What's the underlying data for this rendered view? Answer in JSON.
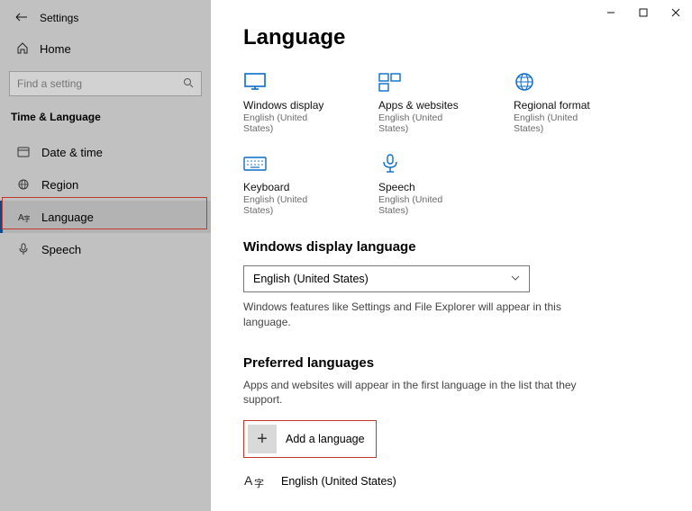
{
  "window": {
    "title": "Settings"
  },
  "sidebar": {
    "home": "Home",
    "search_placeholder": "Find a setting",
    "category": "Time & Language",
    "items": [
      {
        "label": "Date & time",
        "icon": "clock"
      },
      {
        "label": "Region",
        "icon": "globe"
      },
      {
        "label": "Language",
        "icon": "lang",
        "selected": true
      },
      {
        "label": "Speech",
        "icon": "mic"
      }
    ]
  },
  "page": {
    "title": "Language",
    "tiles": [
      {
        "name": "Windows display",
        "sub": "English (United States)",
        "icon": "monitor"
      },
      {
        "name": "Apps & websites",
        "sub": "English (United States)",
        "icon": "apps"
      },
      {
        "name": "Regional format",
        "sub": "English (United States)",
        "icon": "globe2"
      },
      {
        "name": "Keyboard",
        "sub": "English (United States)",
        "icon": "keyboard"
      },
      {
        "name": "Speech",
        "sub": "English (United States)",
        "icon": "mic2"
      }
    ],
    "display_section": {
      "heading": "Windows display language",
      "selected": "English (United States)",
      "note": "Windows features like Settings and File Explorer will appear in this language."
    },
    "preferred_section": {
      "heading": "Preferred languages",
      "note": "Apps and websites will appear in the first language in the list that they support.",
      "add_label": "Add a language",
      "entries": [
        {
          "label": "English (United States)"
        }
      ]
    }
  }
}
